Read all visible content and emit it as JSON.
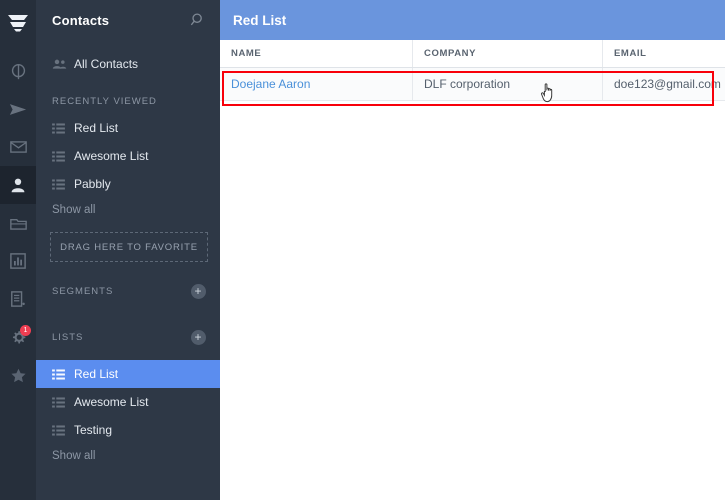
{
  "rail": {
    "logo_name": "app-logo",
    "items": [
      {
        "icon": "dashboard-icon",
        "name": "rail-item-dashboard",
        "active": false,
        "badge": ""
      },
      {
        "icon": "send-icon",
        "name": "rail-item-campaigns",
        "active": false,
        "badge": ""
      },
      {
        "icon": "mail-icon",
        "name": "rail-item-mail",
        "active": false,
        "badge": ""
      },
      {
        "icon": "person-icon",
        "name": "rail-item-contacts",
        "active": true,
        "badge": ""
      },
      {
        "icon": "folder-icon",
        "name": "rail-item-files",
        "active": false,
        "badge": ""
      },
      {
        "icon": "chart-icon",
        "name": "rail-item-reports",
        "active": false,
        "badge": ""
      },
      {
        "icon": "document-icon",
        "name": "rail-item-templates",
        "active": false,
        "badge": ""
      },
      {
        "icon": "gear-icon",
        "name": "rail-item-settings",
        "active": false,
        "badge": "1"
      },
      {
        "icon": "star-icon",
        "name": "rail-item-favorites",
        "active": false,
        "badge": ""
      }
    ]
  },
  "sidebar": {
    "title": "Contacts",
    "search_icon": "search-icon",
    "all_contacts": "All Contacts",
    "recently_viewed_label": "RECENTLY VIEWED",
    "recently_viewed": [
      {
        "label": "Red List"
      },
      {
        "label": "Awesome List"
      },
      {
        "label": "Pabbly"
      }
    ],
    "recently_viewed_show_all": "Show all",
    "drag_here": "DRAG HERE TO FAVORITE",
    "segments_label": "SEGMENTS",
    "segments_add": "+",
    "lists_label": "LISTS",
    "lists_add": "+",
    "lists": [
      {
        "label": "Red List",
        "selected": true
      },
      {
        "label": "Awesome List",
        "selected": false
      },
      {
        "label": "Testing",
        "selected": false
      }
    ],
    "lists_show_all": "Show all"
  },
  "main": {
    "header_title": "Red List",
    "table": {
      "columns": [
        "NAME",
        "COMPANY",
        "EMAIL"
      ],
      "rows": [
        {
          "name": "Doejane Aaron",
          "company": "DLF corporation",
          "email": "doe123@gmail.com"
        }
      ]
    },
    "annotation": {
      "type": "highlight-box",
      "color": "#f8000a"
    },
    "cursor": {
      "type": "pointer-hand-cursor"
    }
  },
  "colors": {
    "rail_bg": "#262f3b",
    "sidebar_bg": "#2e3846",
    "accent_blue": "#6a95dd",
    "selected_blue": "#5b8def",
    "link_blue": "#4a90d9",
    "annotation_red": "#f8000a",
    "badge_red": "#ef3e52"
  }
}
